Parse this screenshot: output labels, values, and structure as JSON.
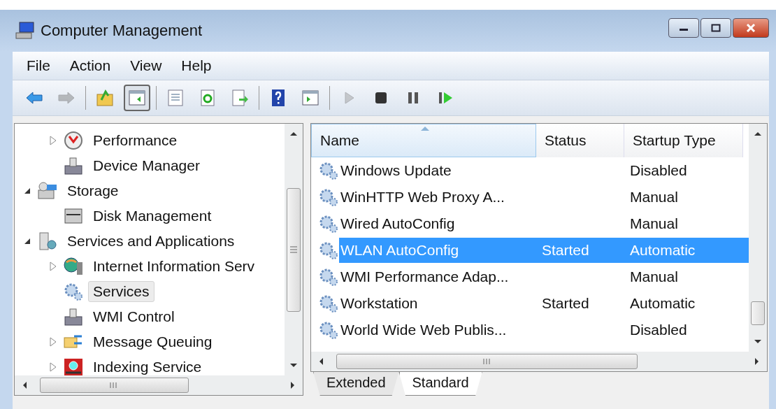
{
  "window": {
    "title": "Computer Management"
  },
  "menu": [
    "File",
    "Action",
    "View",
    "Help"
  ],
  "toolbar": [
    {
      "kind": "button",
      "disabled": false,
      "pressed": false
    },
    {
      "kind": "button",
      "disabled": true,
      "pressed": false
    },
    {
      "kind": "separator"
    },
    {
      "kind": "button",
      "disabled": false,
      "pressed": false
    },
    {
      "kind": "button",
      "disabled": false,
      "pressed": true
    },
    {
      "kind": "separator"
    },
    {
      "kind": "button",
      "disabled": false,
      "pressed": false
    },
    {
      "kind": "button",
      "disabled": false,
      "pressed": false
    },
    {
      "kind": "button",
      "disabled": false,
      "pressed": false
    },
    {
      "kind": "separator"
    },
    {
      "kind": "button",
      "disabled": false,
      "pressed": false
    },
    {
      "kind": "button",
      "disabled": false,
      "pressed": false
    },
    {
      "kind": "separator"
    },
    {
      "kind": "button",
      "disabled": true,
      "pressed": false
    },
    {
      "kind": "button",
      "disabled": false,
      "pressed": false
    },
    {
      "kind": "button",
      "disabled": false,
      "pressed": false
    },
    {
      "kind": "button",
      "disabled": false,
      "pressed": false
    }
  ],
  "tree": [
    {
      "children": [
        {
          "label": "Performance",
          "expanded": false,
          "selected": false
        },
        {
          "label": "Device Manager",
          "selected": false
        }
      ]
    },
    {
      "label": "Storage",
      "expanded": true,
      "selected": false,
      "children": [
        {
          "label": "Disk Management",
          "selected": false
        }
      ]
    },
    {
      "label": "Services and Applications",
      "expanded": true,
      "selected": false,
      "children": [
        {
          "label": "Internet Information Serv",
          "expanded": false,
          "selected": false
        },
        {
          "label": "Services",
          "selected": true
        },
        {
          "label": "WMI Control",
          "selected": false
        },
        {
          "label": "Message Queuing",
          "expanded": false,
          "selected": false
        },
        {
          "label": "Indexing Service",
          "expanded": false,
          "selected": false
        }
      ]
    }
  ],
  "table": {
    "columns": [
      {
        "label": "Name",
        "sorted": true
      },
      {
        "label": "Status",
        "sorted": false
      },
      {
        "label": "Startup Type",
        "sorted": false
      }
    ],
    "rows": [
      {
        "name": "Windows Update",
        "status": "",
        "startup": "Disabled",
        "selected": false
      },
      {
        "name": "WinHTTP Web Proxy A...",
        "status": "",
        "startup": "Manual",
        "selected": false
      },
      {
        "name": "Wired AutoConfig",
        "status": "",
        "startup": "Manual",
        "selected": false
      },
      {
        "name": "WLAN AutoConfig",
        "status": "Started",
        "startup": "Automatic",
        "selected": true
      },
      {
        "name": "WMI Performance Adap...",
        "status": "",
        "startup": "Manual",
        "selected": false
      },
      {
        "name": "Workstation",
        "status": "Started",
        "startup": "Automatic",
        "selected": false
      },
      {
        "name": "World Wide Web Publis...",
        "status": "",
        "startup": "Disabled",
        "selected": false
      }
    ]
  },
  "tabs": [
    {
      "label": "Extended",
      "selected": false
    },
    {
      "label": "Standard",
      "selected": true
    }
  ]
}
